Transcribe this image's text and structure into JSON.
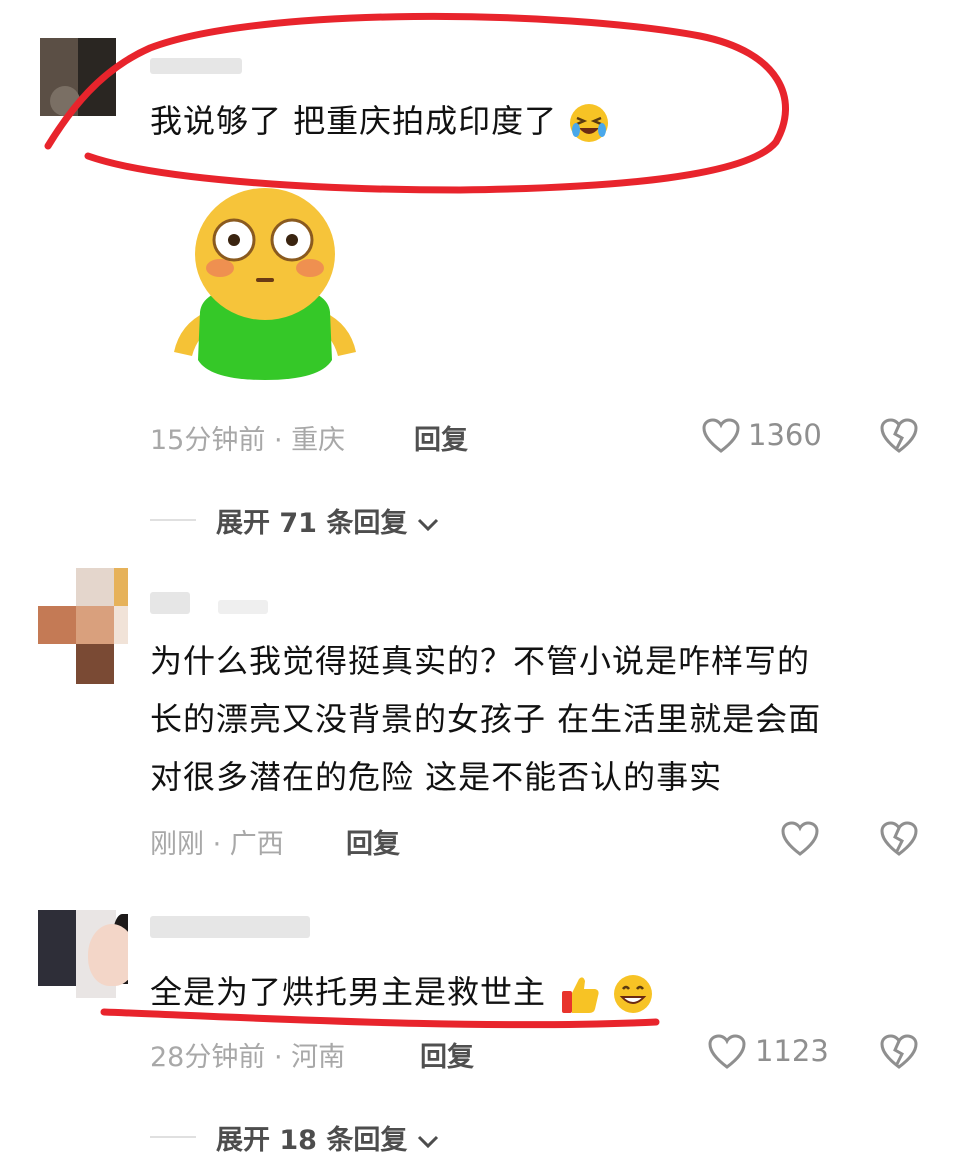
{
  "comments": [
    {
      "text": "我说够了 把重庆拍成印度了",
      "time_location": "15分钟前 · 重庆",
      "reply_label": "回复",
      "likes": "1360",
      "expand_label": "展开 71 条回复"
    },
    {
      "text_lines": [
        "为什么我觉得挺真实的？不管小说是咋样写的",
        "长的漂亮又没背景的女孩子  在生活里就是会面",
        "对很多潜在的危险   这是不能否认的事实"
      ],
      "time_location": "刚刚 · 广西",
      "reply_label": "回复",
      "likes": ""
    },
    {
      "text": "全是为了烘托男主是救世主",
      "time_location": "28分钟前 · 河南",
      "reply_label": "回复",
      "likes": "1123",
      "expand_label": "展开 18 条回复"
    }
  ],
  "icons": {
    "like": "heart-outline-icon",
    "dislike": "broken-heart-icon",
    "expand": "chevron-down-icon"
  },
  "colors": {
    "annotation_red": "#e8242c",
    "meta_gray": "#a8a8a8"
  }
}
